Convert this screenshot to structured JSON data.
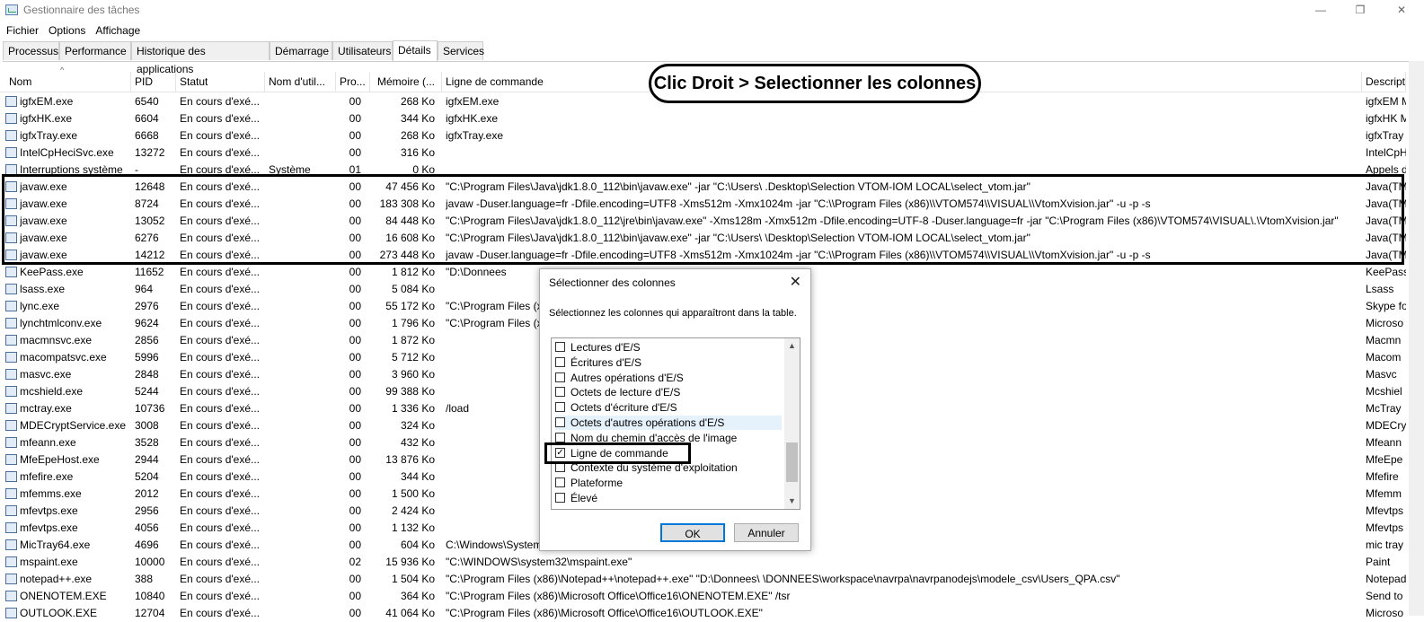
{
  "window": {
    "title": "Gestionnaire des tâches"
  },
  "menu": [
    "Fichier",
    "Options",
    "Affichage"
  ],
  "tabs": [
    "Processus",
    "Performance",
    "Historique des applications",
    "Démarrage",
    "Utilisateurs",
    "Détails",
    "Services"
  ],
  "active_tab": "Détails",
  "columns": [
    "Nom",
    "PID",
    "Statut",
    "Nom d'util...",
    "Pro...",
    "Mémoire (...",
    "Ligne de commande",
    "Descript"
  ],
  "annotation": "Clic Droit > Selectionner les colonnes",
  "rows": [
    [
      "igfxEM.exe",
      "6540",
      "En cours d'exé...",
      "",
      "00",
      "268 Ko",
      "igfxEM.exe",
      "igfxEM M"
    ],
    [
      "igfxHK.exe",
      "6604",
      "En cours d'exé...",
      "",
      "00",
      "344 Ko",
      "igfxHK.exe",
      "igfxHK M"
    ],
    [
      "igfxTray.exe",
      "6668",
      "En cours d'exé...",
      "",
      "00",
      "268 Ko",
      "igfxTray.exe",
      "igfxTray"
    ],
    [
      "IntelCpHeciSvc.exe",
      "13272",
      "En cours d'exé...",
      "",
      "00",
      "316 Ko",
      "",
      "IntelCpH"
    ],
    [
      "Interruptions système",
      "-",
      "En cours d'exé...",
      "Système",
      "01",
      "0 Ko",
      "",
      "Appels d"
    ],
    [
      "javaw.exe",
      "12648",
      "En cours d'exé...",
      "",
      "00",
      "47 456 Ko",
      "\"C:\\Program Files\\Java\\jdk1.8.0_112\\bin\\javaw.exe\" -jar \"C:\\Users\\                .Desktop\\Selection VTOM-IOM LOCAL\\select_vtom.jar\"",
      "Java(TM"
    ],
    [
      "javaw.exe",
      "8724",
      "En cours d'exé...",
      "",
      "00",
      "183 308 Ko",
      "javaw -Duser.language=fr -Dfile.encoding=UTF8 -Xms512m -Xmx1024m -jar \"C:\\\\Program Files (x86)\\\\VTOM574\\\\VISUAL\\\\VtomXvision.jar\" -u                -p                -s",
      "Java(TM"
    ],
    [
      "javaw.exe",
      "13052",
      "En cours d'exé...",
      "",
      "00",
      "84 448 Ko",
      "\"C:\\Program Files\\Java\\jdk1.8.0_112\\jre\\bin\\javaw.exe\" -Xms128m -Xmx512m -Dfile.encoding=UTF-8 -Duser.language=fr -jar \"C:\\Program Files (x86)\\VTOM574\\VISUAL\\.\\VtomXvision.jar\"",
      "Java(TM"
    ],
    [
      "javaw.exe",
      "6276",
      "En cours d'exé...",
      "",
      "00",
      "16 608 Ko",
      "\"C:\\Program Files\\Java\\jdk1.8.0_112\\bin\\javaw.exe\" -jar \"C:\\Users\\                \\Desktop\\Selection VTOM-IOM LOCAL\\select_vtom.jar\"",
      "Java(TM"
    ],
    [
      "javaw.exe",
      "14212",
      "En cours d'exé...",
      "",
      "00",
      "273 448 Ko",
      "javaw -Duser.language=fr -Dfile.encoding=UTF8 -Xms512m -Xmx1024m -jar \"C:\\\\Program Files (x86)\\\\VTOM574\\\\VISUAL\\\\VtomXvision.jar\" -u                -p                -s",
      "Java(TM"
    ],
    [
      "KeePass.exe",
      "11652",
      "En cours d'exé...",
      "",
      "00",
      "1 812 Ko",
      "\"D:\\Donnees",
      "KeePass"
    ],
    [
      "lsass.exe",
      "964",
      "En cours d'exé...",
      "",
      "00",
      "5 084 Ko",
      "",
      "Lsass"
    ],
    [
      "lync.exe",
      "2976",
      "En cours d'exé...",
      "",
      "00",
      "55 172 Ko",
      "\"C:\\Program Files (x",
      "Skype fo"
    ],
    [
      "lynchtmlconv.exe",
      "9624",
      "En cours d'exé...",
      "",
      "00",
      "1 796 Ko",
      "\"C:\\Program Files (x                                                                                ding",
      "Microso"
    ],
    [
      "macmnsvc.exe",
      "2856",
      "En cours d'exé...",
      "",
      "00",
      "1 872 Ko",
      "",
      "Macmn"
    ],
    [
      "macompatsvc.exe",
      "5996",
      "En cours d'exé...",
      "",
      "00",
      "5 712 Ko",
      "",
      "Macom"
    ],
    [
      "masvc.exe",
      "2848",
      "En cours d'exé...",
      "",
      "00",
      "3 960 Ko",
      "",
      "Masvc"
    ],
    [
      "mcshield.exe",
      "5244",
      "En cours d'exé...",
      "",
      "00",
      "99 388 Ko",
      "",
      "Mcshiel"
    ],
    [
      "mctray.exe",
      "10736",
      "En cours d'exé...",
      "",
      "00",
      "1 336 Ko",
      "/load",
      "McTray"
    ],
    [
      "MDECryptService.exe",
      "3008",
      "En cours d'exé...",
      "",
      "00",
      "324 Ko",
      "",
      "MDECry"
    ],
    [
      "mfeann.exe",
      "3528",
      "En cours d'exé...",
      "",
      "00",
      "432 Ko",
      "",
      "Mfeann"
    ],
    [
      "MfeEpeHost.exe",
      "2944",
      "En cours d'exé...",
      "",
      "00",
      "13 876 Ko",
      "",
      "MfeEpe"
    ],
    [
      "mfefire.exe",
      "5204",
      "En cours d'exé...",
      "",
      "00",
      "344 Ko",
      "",
      "Mfefire"
    ],
    [
      "mfemms.exe",
      "2012",
      "En cours d'exé...",
      "",
      "00",
      "1 500 Ko",
      "",
      "Mfemm"
    ],
    [
      "mfevtps.exe",
      "2956",
      "En cours d'exé...",
      "",
      "00",
      "2 424 Ko",
      "",
      "Mfevtps"
    ],
    [
      "mfevtps.exe",
      "4056",
      "En cours d'exé...",
      "",
      "00",
      "1 132 Ko",
      "",
      "Mfevtps"
    ],
    [
      "MicTray64.exe",
      "4696",
      "En cours d'exé...",
      "",
      "00",
      "604 Ko",
      "C:\\Windows\\System",
      "mic tray"
    ],
    [
      "mspaint.exe",
      "10000",
      "En cours d'exé...",
      "",
      "02",
      "15 936 Ko",
      "\"C:\\WINDOWS\\system32\\mspaint.exe\"",
      "Paint"
    ],
    [
      "notepad++.exe",
      "388",
      "En cours d'exé...",
      "",
      "00",
      "1 504 Ko",
      "\"C:\\Program Files (x86)\\Notepad++\\notepad++.exe\"  \"D:\\Donnees\\                \\DONNEES\\workspace\\navrpa\\navrpanodejs\\modele_csv\\Users_QPA.csv\"",
      "Notepad"
    ],
    [
      "ONENOTEM.EXE",
      "10840",
      "En cours d'exé...",
      "",
      "00",
      "364 Ko",
      "\"C:\\Program Files (x86)\\Microsoft Office\\Office16\\ONENOTEM.EXE\" /tsr",
      "Send to"
    ],
    [
      "OUTLOOK.EXE",
      "12704",
      "En cours d'exé...",
      "",
      "00",
      "41 064 Ko",
      "\"C:\\Program Files (x86)\\Microsoft Office\\Office16\\OUTLOOK.EXE\"",
      "Microso"
    ]
  ],
  "dialog": {
    "title": "Sélectionner des colonnes",
    "close": "✕",
    "description": "Sélectionnez les colonnes qui apparaîtront dans la table.",
    "items": [
      {
        "label": "Lectures d'E/S",
        "checked": false
      },
      {
        "label": "Écritures d'E/S",
        "checked": false
      },
      {
        "label": "Autres opérations d'E/S",
        "checked": false
      },
      {
        "label": "Octets de lecture d'E/S",
        "checked": false
      },
      {
        "label": "Octets d'écriture d'E/S",
        "checked": false
      },
      {
        "label": "Octets d'autres opérations d'E/S",
        "checked": false
      },
      {
        "label": "Nom du chemin d'accès de l'image",
        "checked": false
      },
      {
        "label": "Ligne de commande",
        "checked": true
      },
      {
        "label": "Contexte du système d'exploitation",
        "checked": false
      },
      {
        "label": "Plateforme",
        "checked": false
      },
      {
        "label": "Élevé",
        "checked": false
      }
    ],
    "ok": "OK",
    "cancel": "Annuler"
  }
}
